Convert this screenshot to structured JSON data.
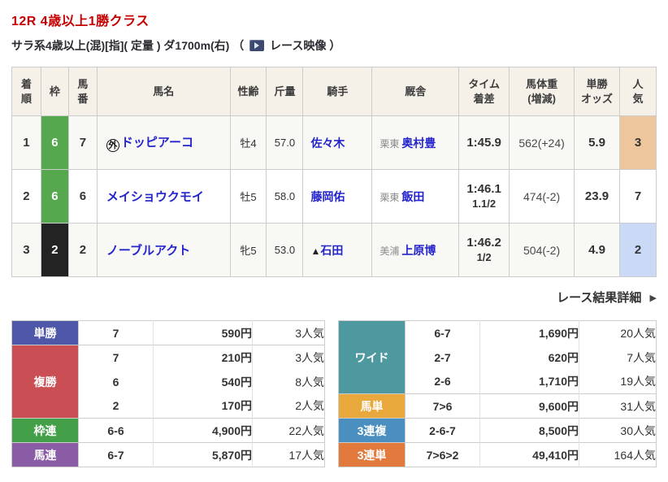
{
  "colors": {
    "title-red": "#c60000",
    "link-blue": "#2424cc",
    "frame-green": "#55a84e",
    "frame-black": "#232323",
    "pop-first-bg": "#edc69d",
    "pop-third-bg": "#c9d9f6",
    "header-bg": "#f5f1e8",
    "row-alt-bg": "#f8f8f5",
    "tansho": "#4f58a8",
    "fukusho": "#c94f55",
    "wakuren": "#44a048",
    "umaren": "#8a5ca6",
    "wide": "#4e99a0",
    "umatan": "#e9a83b",
    "sanrenpuku": "#4a8fc0",
    "sanrentan": "#e2793d"
  },
  "race": {
    "title": "12R 4歳以上1勝クラス",
    "conditions": "サラ系4歳以上(混)[指]( 定量 ) ダ1700m(右)",
    "paren_open": "（",
    "video_label": "レース映像",
    "paren_close": "）"
  },
  "results": {
    "headers": [
      "着\n順",
      "枠",
      "馬\n番",
      "馬名",
      "性齢",
      "斤量",
      "騎手",
      "厩舎",
      "タイム\n着差",
      "馬体重\n(増減)",
      "単勝\nオッズ",
      "人\n気"
    ],
    "rows": [
      {
        "pos": "1",
        "bracket": "6",
        "number": "7",
        "mark": "外",
        "horse": "ドッピアーコ",
        "sex_age": "牡4",
        "weight": "57.0",
        "jockey_mark": "",
        "jockey": "佐々木",
        "region": "栗東",
        "trainer": "奥村豊",
        "time": "1:45.9",
        "margin": "",
        "body_weight": "562(+24)",
        "odds": "5.9",
        "pop": "3"
      },
      {
        "pos": "2",
        "bracket": "6",
        "number": "6",
        "mark": "",
        "horse": "メイショウクモイ",
        "sex_age": "牡5",
        "weight": "58.0",
        "jockey_mark": "",
        "jockey": "藤岡佑",
        "region": "栗東",
        "trainer": "飯田",
        "time": "1:46.1",
        "margin": "1.1/2",
        "body_weight": "474(-2)",
        "odds": "23.9",
        "pop": "7"
      },
      {
        "pos": "3",
        "bracket": "2",
        "number": "2",
        "mark": "",
        "horse": "ノーブルアクト",
        "sex_age": "牝5",
        "weight": "53.0",
        "jockey_mark": "▲",
        "jockey": "石田",
        "region": "美浦",
        "trainer": "上原博",
        "time": "1:46.2",
        "margin": "1/2",
        "body_weight": "504(-2)",
        "odds": "4.9",
        "pop": "2"
      }
    ]
  },
  "detail_link": {
    "label": "レース結果詳細",
    "arrow": "▶"
  },
  "payouts": {
    "tansho": {
      "label": "単勝",
      "combo": "7",
      "amount": "590円",
      "pop": "3人気"
    },
    "fukusho": {
      "label": "複勝",
      "rows": [
        {
          "combo": "7",
          "amount": "210円",
          "pop": "3人気"
        },
        {
          "combo": "6",
          "amount": "540円",
          "pop": "8人気"
        },
        {
          "combo": "2",
          "amount": "170円",
          "pop": "2人気"
        }
      ]
    },
    "wakuren": {
      "label": "枠連",
      "combo": "6-6",
      "amount": "4,900円",
      "pop": "22人気"
    },
    "umaren": {
      "label": "馬連",
      "combo": "6-7",
      "amount": "5,870円",
      "pop": "17人気"
    },
    "wide": {
      "label": "ワイド",
      "rows": [
        {
          "combo": "6-7",
          "amount": "1,690円",
          "pop": "20人気"
        },
        {
          "combo": "2-7",
          "amount": "620円",
          "pop": "7人気"
        },
        {
          "combo": "2-6",
          "amount": "1,710円",
          "pop": "19人気"
        }
      ]
    },
    "umatan": {
      "label": "馬単",
      "combo": "7>6",
      "amount": "9,600円",
      "pop": "31人気"
    },
    "sanrenpuku": {
      "label": "3連複",
      "combo": "2-6-7",
      "amount": "8,500円",
      "pop": "30人気"
    },
    "sanrentan": {
      "label": "3連単",
      "combo": "7>6>2",
      "amount": "49,410円",
      "pop": "164人気"
    }
  }
}
